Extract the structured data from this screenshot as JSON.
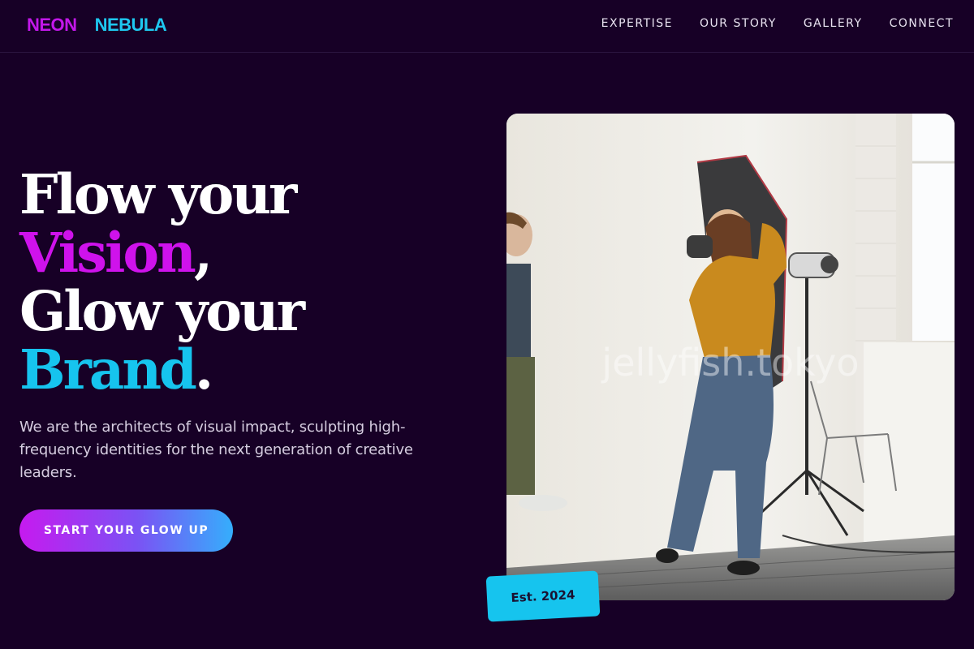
{
  "brand": {
    "word1": "NEON",
    "word2": "NEBULA"
  },
  "nav": {
    "items": [
      "EXPERTISE",
      "OUR STORY",
      "GALLERY",
      "CONNECT"
    ]
  },
  "hero": {
    "line1": "Flow your",
    "line2_accent": "Vision",
    "line2_punct": ",",
    "line3": "Glow your",
    "line4_accent": "Brand",
    "line4_punct": ".",
    "description": "We are the architects of visual impact, sculpting high-frequency identities for the next generation of creative leaders.",
    "cta_label": "START YOUR GLOW UP"
  },
  "photo": {
    "watermark": "jellyfish.tokyo"
  },
  "badge": {
    "label": "Est. 2024"
  },
  "colors": {
    "background": "#170026",
    "magenta": "#cf12ec",
    "cyan": "#16c4ee",
    "button_gradient_start": "#c61aef",
    "button_gradient_end": "#35aefc"
  }
}
